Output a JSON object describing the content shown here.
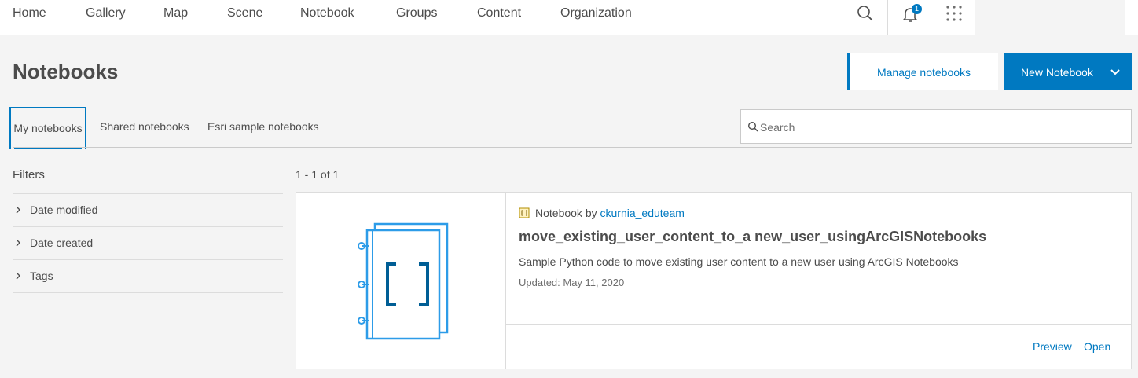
{
  "nav": {
    "items": [
      {
        "name": "nav-home",
        "label": "Home"
      },
      {
        "name": "nav-gallery",
        "label": "Gallery"
      },
      {
        "name": "nav-map",
        "label": "Map"
      },
      {
        "name": "nav-scene",
        "label": "Scene"
      },
      {
        "name": "nav-notebook",
        "label": "Notebook"
      },
      {
        "name": "nav-groups",
        "label": "Groups"
      },
      {
        "name": "nav-content",
        "label": "Content"
      },
      {
        "name": "nav-organization",
        "label": "Organization"
      }
    ],
    "notification_count": "1",
    "icons": [
      "search-icon",
      "bell-icon",
      "app-launcher-icon"
    ]
  },
  "header": {
    "title": "Notebooks",
    "manage_label": "Manage notebooks",
    "new_label": "New Notebook"
  },
  "tabs": [
    {
      "label": "My notebooks",
      "active": true
    },
    {
      "label": "Shared notebooks",
      "active": false
    },
    {
      "label": "Esri sample notebooks",
      "active": false
    }
  ],
  "search": {
    "placeholder": "Search",
    "value": ""
  },
  "filters": {
    "title": "Filters",
    "items": [
      "Date modified",
      "Date created",
      "Tags"
    ]
  },
  "results": {
    "count_text": "1 - 1 of 1",
    "items": [
      {
        "type_label": "Notebook by",
        "owner": "ckurnia_eduteam",
        "title": "move_existing_user_content_to_a new_user_usingArcGISNotebooks",
        "snippet": "Sample Python code to move existing user content to a new user using ArcGIS Notebooks",
        "updated": "Updated: May 11, 2020",
        "actions": [
          "Preview",
          "Open"
        ]
      }
    ]
  },
  "colors": {
    "accent": "#0079c1",
    "thumbnail": "#2d9ce8",
    "thumbnail_bracket": "#005e95"
  }
}
